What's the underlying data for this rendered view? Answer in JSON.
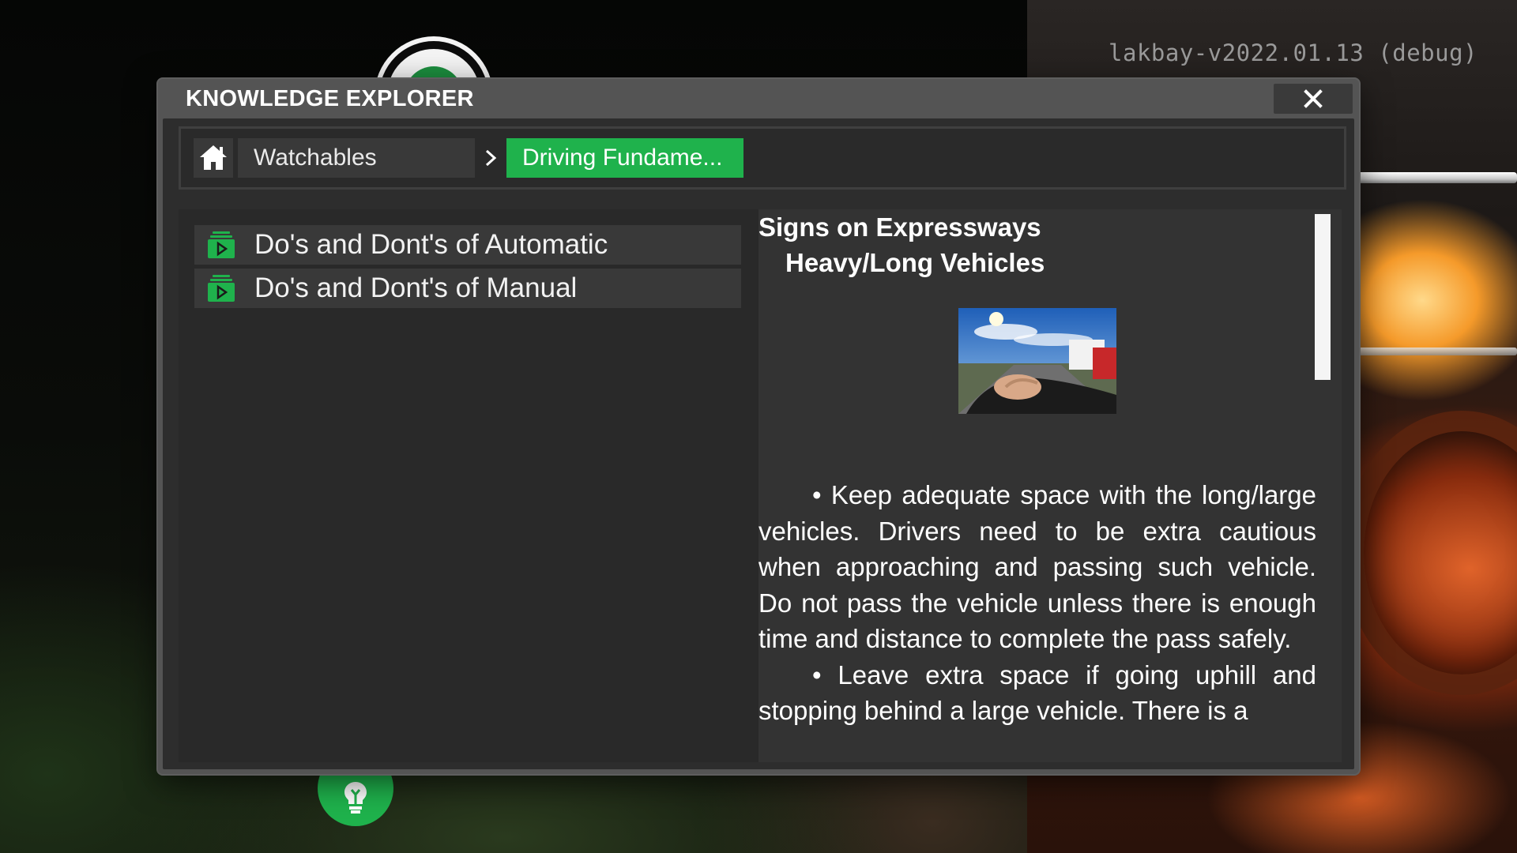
{
  "version": "lakbay-v2022.01.13 (debug)",
  "window": {
    "title": "KNOWLEDGE EXPLORER",
    "close_icon": "close-icon"
  },
  "breadcrumb": {
    "home_icon": "home-icon",
    "items": [
      "Watchables"
    ],
    "separator_icon": "chevron-right-icon",
    "active": "Driving Fundame..."
  },
  "list": {
    "items": [
      {
        "label": "Do's and Dont's of Automatic",
        "icon": "video-folder-icon"
      },
      {
        "label": "Do's and Dont's of Manual",
        "icon": "video-folder-icon"
      }
    ]
  },
  "content": {
    "title": "Signs on Expressways",
    "subtitle": "Heavy/Long Vehicles",
    "bullet_1": "•   Keep adequate space with the long/large vehicles. Drivers need to be extra cautious when approaching and passing such vehicle. Do not pass the vehicle unless there is enough time and distance to complete the pass safely.",
    "bullet_2": "• Leave extra space if going uphill and stopping behind a large vehicle. There is a",
    "scroll_position": 0.0
  },
  "colors": {
    "accent": "#1fb24c",
    "window_frame": "#545454",
    "panel_bg": "#2d2d2d",
    "item_bg": "#393939"
  }
}
